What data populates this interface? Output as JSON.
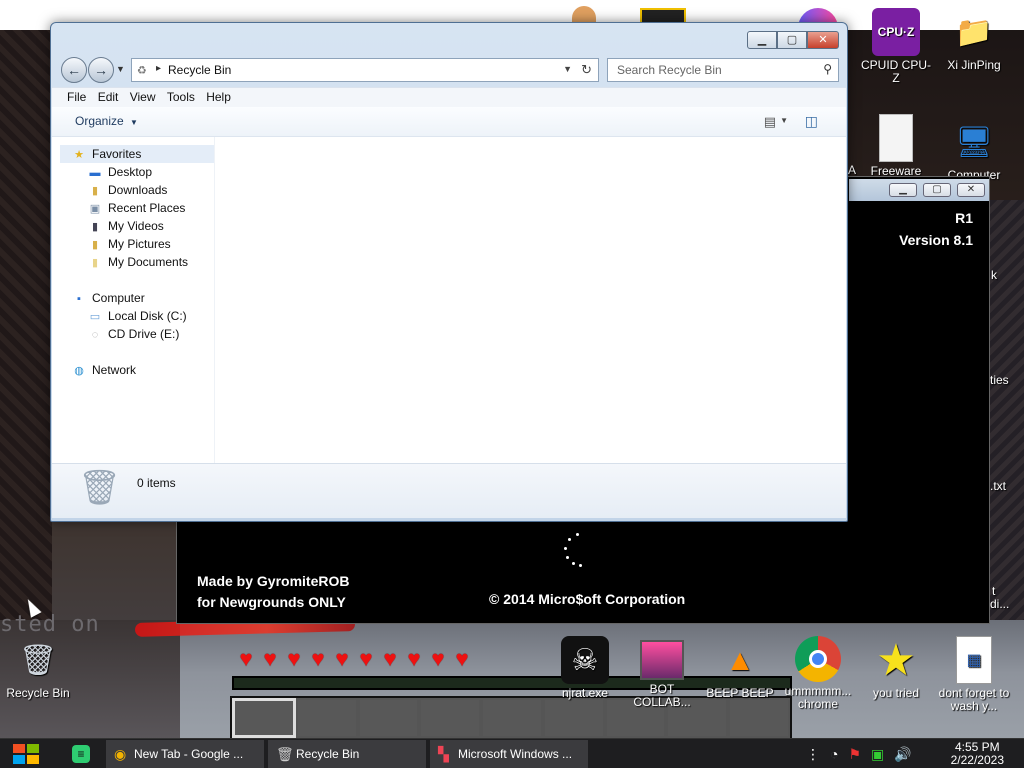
{
  "desktop": {
    "icons": [
      {
        "label": "CPUID CPU-Z",
        "glyph": "cpu-icon"
      },
      {
        "label": "Xi JinPing",
        "glyph": "user-folder-icon"
      },
      {
        "label": "Freeware",
        "glyph": "document-icon"
      },
      {
        "label": "Computer",
        "glyph": "computer-icon"
      },
      {
        "label": "Recycle Bin",
        "glyph": "recycle-bin-icon"
      },
      {
        "label": "njrat.exe",
        "glyph": "skull-icon"
      },
      {
        "label": "BOT COLLAB...",
        "glyph": "monitor-icon"
      },
      {
        "label": "BEEP BEEP",
        "glyph": "vlc-cone-icon"
      },
      {
        "label": "ummmmm... chrome",
        "glyph": "chrome-icon"
      },
      {
        "label": "you tried",
        "glyph": "star-icon"
      },
      {
        "label": "dont forget to wash y...",
        "glyph": "calendar-file-icon"
      }
    ],
    "partial_labels": {
      "a": "A",
      "k": "k",
      "ties": "ties",
      "txt": ".txt",
      "t": "t",
      "di": "di..."
    },
    "ghost_text": "sted on",
    "hearts": 10,
    "hotbar_slots": 9
  },
  "installer": {
    "r1": "R1",
    "version": "Version 8.1",
    "made_by": [
      "Made by GyromiteROB",
      "for Newgrounds ONLY"
    ],
    "copyright": "© 2014 Micro$oft Corporation",
    "buttons": {
      "min": "▁",
      "max": "▢",
      "close": "✕"
    }
  },
  "explorer": {
    "buttons": {
      "min": "▁",
      "max": "▢",
      "close": "✕"
    },
    "nav": {
      "back": "←",
      "forward": "→"
    },
    "address": "Recycle Bin",
    "search_placeholder": "Search Recycle Bin",
    "menu": [
      "File",
      "Edit",
      "View",
      "Tools",
      "Help"
    ],
    "organize": "Organize",
    "nav_pane": {
      "favorites": "Favorites",
      "fav_items": [
        "Desktop",
        "Downloads",
        "Recent Places",
        "My Videos",
        "My Pictures",
        "My Documents"
      ],
      "computer": "Computer",
      "computer_items": [
        "Local Disk (C:)",
        "CD Drive (E:)"
      ],
      "network": "Network"
    },
    "status": "0 items"
  },
  "taskbar": {
    "tasks": [
      {
        "label": "New Tab - Google ...",
        "icon": "chrome-icon"
      },
      {
        "label": "Recycle Bin",
        "icon": "recycle-bin-icon"
      },
      {
        "label": "Microsoft Windows ...",
        "icon": "windows-setup-icon"
      }
    ],
    "time": "4:55 PM",
    "date": "2/22/2023"
  },
  "colors": {
    "accent": "#3a6ea5",
    "heart": "#e11111",
    "start_blue": "#1e90ff"
  }
}
